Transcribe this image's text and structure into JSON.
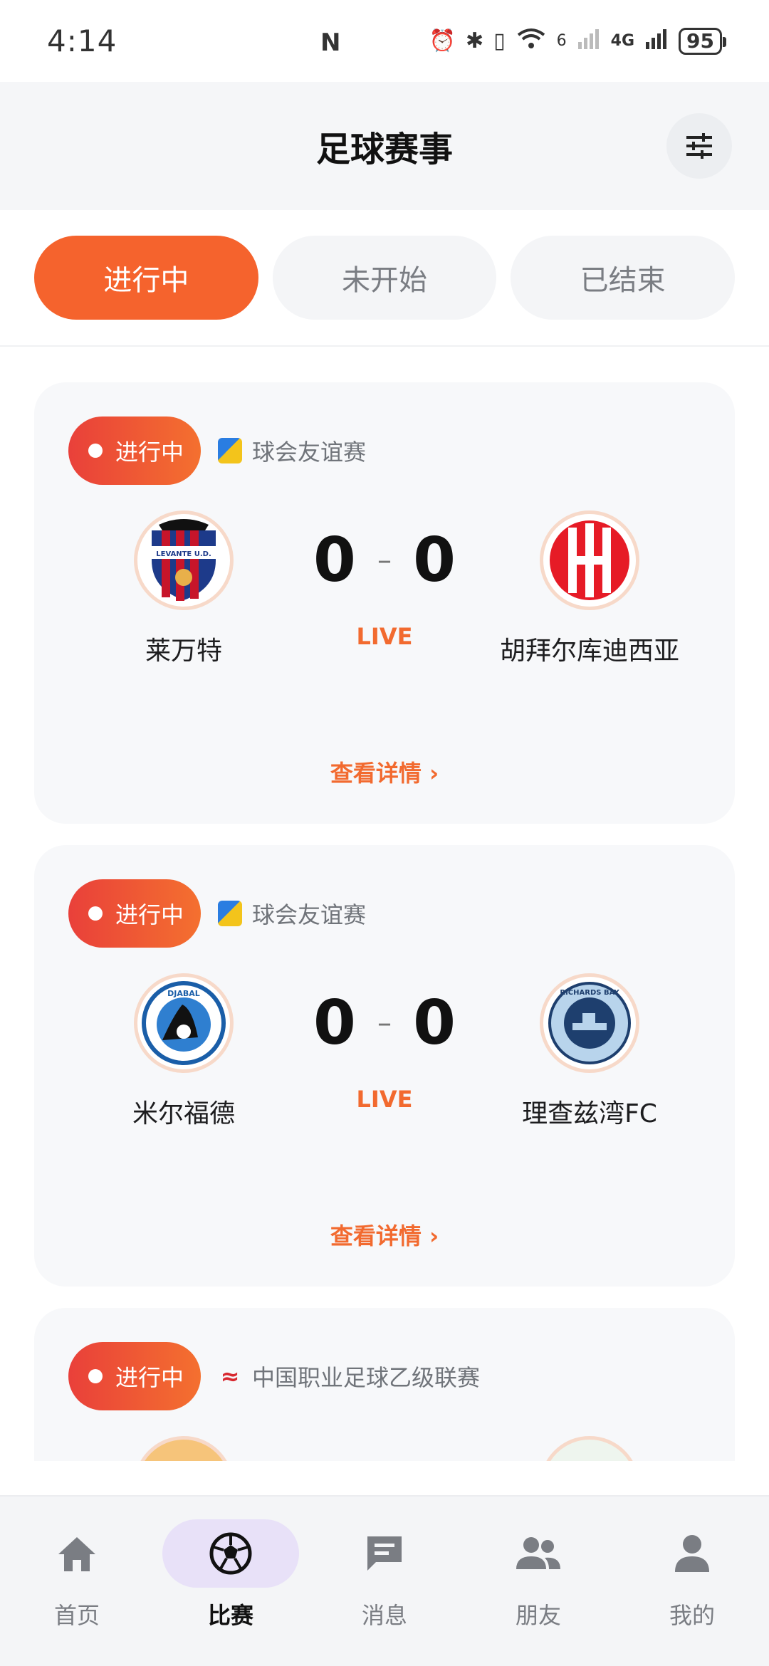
{
  "status_bar": {
    "time": "4:14",
    "nfc": "N",
    "signal_labels": [
      "6",
      "4G"
    ],
    "battery": "95"
  },
  "header": {
    "title": "足球赛事",
    "filter_icon": "sliders-icon"
  },
  "tabs": [
    {
      "label": "进行中",
      "active": true
    },
    {
      "label": "未开始",
      "active": false
    },
    {
      "label": "已结束",
      "active": false
    }
  ],
  "matches": [
    {
      "status": "进行中",
      "league": "球会友谊赛",
      "home": {
        "name": "莱万特",
        "logo_text": "LEVANTE U.D."
      },
      "away": {
        "name": "胡拜尔库迪西亚",
        "logo_text": ""
      },
      "home_score": "0",
      "away_score": "0",
      "live": "LIVE",
      "details": "查看详情 ›"
    },
    {
      "status": "进行中",
      "league": "球会友谊赛",
      "home": {
        "name": "米尔福德",
        "logo_text": "DJABAL"
      },
      "away": {
        "name": "理查兹湾FC",
        "logo_text": "RICHARDS BAY"
      },
      "home_score": "0",
      "away_score": "0",
      "live": "LIVE",
      "details": "查看详情 ›"
    },
    {
      "status": "进行中",
      "league": "中国职业足球乙级联赛"
    }
  ],
  "nav": [
    {
      "label": "首页",
      "icon": "home-icon",
      "active": false
    },
    {
      "label": "比赛",
      "icon": "soccer-ball-icon",
      "active": true
    },
    {
      "label": "消息",
      "icon": "message-icon",
      "active": false
    },
    {
      "label": "朋友",
      "icon": "friends-icon",
      "active": false
    },
    {
      "label": "我的",
      "icon": "profile-icon",
      "active": false
    }
  ],
  "colors": {
    "accent": "#f5632d",
    "live": "#f26a2f",
    "nav_active_bg": "#e8e1f8"
  }
}
